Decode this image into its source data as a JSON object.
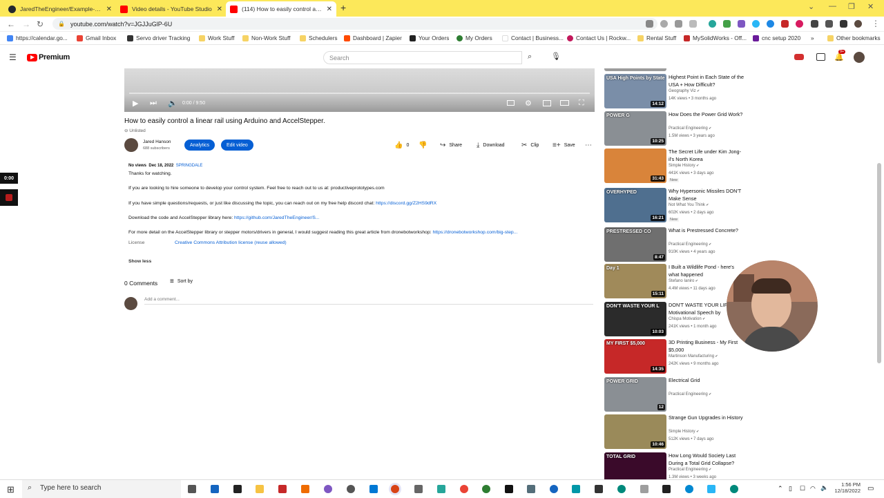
{
  "tabs": [
    {
      "label": "JaredTheEngineer/Example-Linear",
      "color": "#24292f"
    },
    {
      "label": "Video details - YouTube Studio",
      "color": "#ff0000"
    },
    {
      "label": "(114) How to easily control a linear",
      "color": "#ff0000"
    }
  ],
  "omnibox": {
    "url": "youtube.com/watch?v=JGJJuGlP-6U"
  },
  "bookmarks": [
    {
      "label": "https://calendar.go...",
      "color": "#4285f4"
    },
    {
      "label": "Gmail Inbox",
      "color": "#ea4335"
    },
    {
      "label": "Servo driver Tracking",
      "color": "#333333"
    },
    {
      "label": "Work Stuff",
      "color": "#f6d365"
    },
    {
      "label": "Non-Work Stuff",
      "color": "#f6d365"
    },
    {
      "label": "Schedulers",
      "color": "#f6d365"
    },
    {
      "label": "Dashboard | Zapier",
      "color": "#ff4a00"
    },
    {
      "label": "Your Orders",
      "color": "#222222"
    },
    {
      "label": "My Orders",
      "color": "#2e7d32"
    },
    {
      "label": "Contact | Business...",
      "color": "#ffffff"
    },
    {
      "label": "Contact Us | Rockw...",
      "color": "#c2185b"
    },
    {
      "label": "Rental Stuff",
      "color": "#f6d365"
    },
    {
      "label": "MySolidWorks - Off...",
      "color": "#c62828"
    },
    {
      "label": "cnc setup 2020",
      "color": "#6a1b9a"
    },
    {
      "label": "Other bookmarks",
      "color": "#f6d365"
    }
  ],
  "youtube": {
    "logo_text": "Premium",
    "search_placeholder": "Search",
    "notifications": "9+"
  },
  "player": {
    "time": "0:00 / 9:50",
    "progress": 0.0
  },
  "video": {
    "title": "How to easily control a linear rail using Arduino and AccelStepper.",
    "visibility": "Unlisted",
    "channel": "Jared Hanson",
    "subscribers": "688 subscribers",
    "analytics_label": "Analytics",
    "edit_label": "Edit video",
    "likes": "0",
    "share_label": "Share",
    "download_label": "Download",
    "clip_label": "Clip",
    "save_label": "Save"
  },
  "description": {
    "views": "No views",
    "date": "Dec 18, 2022",
    "location": "SPRINGDALE",
    "line1": "Thanks for watching.",
    "line2": "If you are looking to hire someone to develop your control system. Feel free to reach out to us at: productiveprototypes.com",
    "line3_text": "If you have simple questions/requests, or just like discussing the topic, you can reach out on my free help discord chat:",
    "line3_link": "https://discord.gg/Z2HS9dRX",
    "line4_text": "Download the code and AccelStepper library here:",
    "line4_link": "https://github.com/JaredTheEngineer/S...",
    "line5_text": "For more detail on the AccelStepper library or stepper motors/drivers in general, I would suggest reading this great article from dronebotworkshop:",
    "line5_link": "https://dronebotworkshop.com/big-step...",
    "license_label": "License",
    "license_value": "Creative Commons Attribution license (reuse allowed)",
    "show_less": "Show less"
  },
  "comments": {
    "count": "0 Comments",
    "sort": "Sort by",
    "placeholder": "Add a comment..."
  },
  "overlay": {
    "time": "0:00"
  },
  "recommendations": [
    {
      "title": "Highest Point in Each State of the USA + How Difficult?",
      "channel": "Geography Viz",
      "meta": "14K views • 3 months ago",
      "duration": "14:12",
      "thumb_label": "USA High Points by State",
      "bg": "#7a8ea8"
    },
    {
      "title": "How Does the Power Grid Work?",
      "channel": "Practical Engineering",
      "meta": "1.5M views • 3 years ago",
      "duration": "10:25",
      "thumb_label": "POWER G",
      "bg": "#8a8f94"
    },
    {
      "title": "The Secret Life under Kim Jong-il's North Korea",
      "channel": "Simple History",
      "meta": "441K views • 3 days ago",
      "duration": "31:43",
      "thumb_label": "",
      "bg": "#d9843a",
      "badge": "New"
    },
    {
      "title": "Why Hypersonic Missiles DON'T Make Sense",
      "channel": "Not What You Think",
      "meta": "602K views • 2 days ago",
      "duration": "16:21",
      "thumb_label": "OVERHYPED",
      "bg": "#4f6f8f",
      "badge": "New"
    },
    {
      "title": "What is Prestressed Concrete?",
      "channel": "Practical Engineering",
      "meta": "910K views • 4 years ago",
      "duration": "8:47",
      "thumb_label": "PRESTRESSED CO",
      "bg": "#6f6f6f"
    },
    {
      "title": "I Built a Wildlife Pond - here's what happened",
      "channel": "Stefano Ianiro",
      "meta": "4.4M views • 11 days ago",
      "duration": "15:11",
      "thumb_label": "Day 1",
      "bg": "#a08a5a"
    },
    {
      "title": "DON'T WASTE YOUR LIFE - Motivational Speech by",
      "channel": "Chispa Motivation",
      "meta": "241K views • 1 month ago",
      "duration": "10:03",
      "thumb_label": "DON'T WASTE YOUR L",
      "bg": "#2b2b2b"
    },
    {
      "title": "3D Printing Business - My First $5,000",
      "channel": "Martinson Manufacturing",
      "meta": "242K views • 9 months ago",
      "duration": "14:35",
      "thumb_label": "MY FIRST $5,000",
      "bg": "#c62828"
    },
    {
      "title": "Electrical Grid",
      "channel": "Practical Engineering",
      "meta": "",
      "duration": "12",
      "thumb_label": "POWER GRID",
      "bg": "#8a8f94"
    },
    {
      "title": "Strange Gun Upgrades in History",
      "channel": "Simple History",
      "meta": "512K views • 7 days ago",
      "duration": "10:46",
      "thumb_label": "",
      "bg": "#9a8a5a"
    },
    {
      "title": "How Long Would Society Last During a Total Grid Collapse?",
      "channel": "Practical Engineering",
      "meta": "1.3M views • 3 weeks ago",
      "duration": "",
      "thumb_label": "TOTAL GRID",
      "bg": "#3a0a2a"
    }
  ],
  "taskbar": {
    "search_placeholder": "Type here to search",
    "time": "1:56 PM",
    "date": "12/18/2022"
  }
}
